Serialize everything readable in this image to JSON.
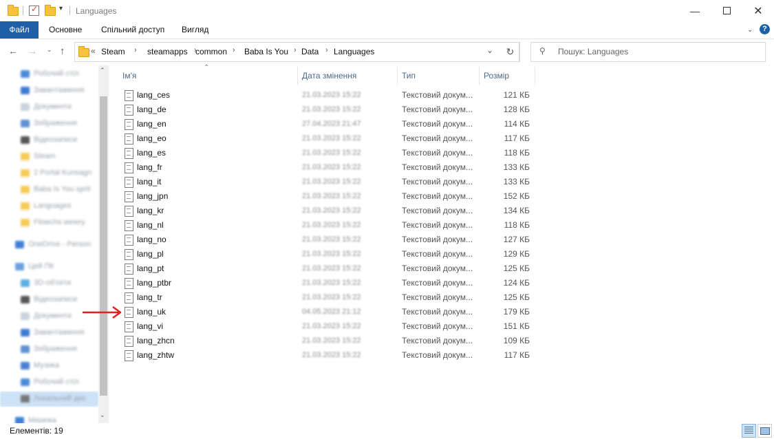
{
  "window": {
    "title": "Languages"
  },
  "ribbon": {
    "tabs": [
      "Файл",
      "Основне",
      "Спільний доступ",
      "Вигляд"
    ]
  },
  "address": {
    "overflow": "«",
    "crumbs": [
      "Steam",
      "steamapps",
      "common",
      "Baba Is You",
      "Data",
      "Languages"
    ]
  },
  "search": {
    "placeholder": "Пошук: Languages"
  },
  "columns": {
    "name": "Ім'я",
    "date": "Дата змінення",
    "type": "Тип",
    "size": "Розмір"
  },
  "files": [
    {
      "name": "lang_ces",
      "date": "21.03.2023 15:22",
      "type": "Текстовий докум...",
      "size": "121 КБ"
    },
    {
      "name": "lang_de",
      "date": "21.03.2023 15:22",
      "type": "Текстовий докум...",
      "size": "128 КБ"
    },
    {
      "name": "lang_en",
      "date": "27.04.2023 21:47",
      "type": "Текстовий докум...",
      "size": "114 КБ"
    },
    {
      "name": "lang_eo",
      "date": "21.03.2023 15:22",
      "type": "Текстовий докум...",
      "size": "117 КБ"
    },
    {
      "name": "lang_es",
      "date": "21.03.2023 15:22",
      "type": "Текстовий докум...",
      "size": "118 КБ"
    },
    {
      "name": "lang_fr",
      "date": "21.03.2023 15:22",
      "type": "Текстовий докум...",
      "size": "133 КБ"
    },
    {
      "name": "lang_it",
      "date": "21.03.2023 15:22",
      "type": "Текстовий докум...",
      "size": "133 КБ"
    },
    {
      "name": "lang_jpn",
      "date": "21.03.2023 15:22",
      "type": "Текстовий докум...",
      "size": "152 КБ"
    },
    {
      "name": "lang_kr",
      "date": "21.03.2023 15:22",
      "type": "Текстовий докум...",
      "size": "134 КБ"
    },
    {
      "name": "lang_nl",
      "date": "21.03.2023 15:22",
      "type": "Текстовий докум...",
      "size": "118 КБ"
    },
    {
      "name": "lang_no",
      "date": "21.03.2023 15:22",
      "type": "Текстовий докум...",
      "size": "127 КБ"
    },
    {
      "name": "lang_pl",
      "date": "21.03.2023 15:22",
      "type": "Текстовий докум...",
      "size": "129 КБ"
    },
    {
      "name": "lang_pt",
      "date": "21.03.2023 15:22",
      "type": "Текстовий докум...",
      "size": "125 КБ"
    },
    {
      "name": "lang_ptbr",
      "date": "21.03.2023 15:22",
      "type": "Текстовий докум...",
      "size": "124 КБ"
    },
    {
      "name": "lang_tr",
      "date": "21.03.2023 15:22",
      "type": "Текстовий докум...",
      "size": "125 КБ"
    },
    {
      "name": "lang_uk",
      "date": "04.05.2023 21:12",
      "type": "Текстовий докум...",
      "size": "179 КБ"
    },
    {
      "name": "lang_vi",
      "date": "21.03.2023 15:22",
      "type": "Текстовий докум...",
      "size": "151 КБ"
    },
    {
      "name": "lang_zhcn",
      "date": "21.03.2023 15:22",
      "type": "Текстовий докум...",
      "size": "109 КБ"
    },
    {
      "name": "lang_zhtw",
      "date": "21.03.2023 15:22",
      "type": "Текстовий докум...",
      "size": "117 КБ"
    }
  ],
  "nav": {
    "items": [
      {
        "label": "Робочий стіл",
        "icon": "desktop-icon"
      },
      {
        "label": "Завантаження",
        "icon": "download-icon"
      },
      {
        "label": "Документи",
        "icon": "documents-icon"
      },
      {
        "label": "Зображення",
        "icon": "pictures-icon"
      },
      {
        "label": "Відеозаписи",
        "icon": "video-icon"
      },
      {
        "label": "Steam",
        "icon": "folder-icon"
      },
      {
        "label": "2 Portal Kunsagn",
        "icon": "folder-icon"
      },
      {
        "label": "Baba Is You sprit",
        "icon": "folder-icon"
      },
      {
        "label": "Languages",
        "icon": "folder-icon"
      },
      {
        "label": "Flowchs wewry",
        "icon": "folder-icon"
      },
      {
        "label": "OneDrive - Person",
        "icon": "onedrive-icon"
      },
      {
        "label": "Цей ПК",
        "icon": "pc-icon"
      },
      {
        "label": "3D-об'єкти",
        "icon": "3d-objects-icon"
      },
      {
        "label": "Відеозаписи",
        "icon": "video-icon"
      },
      {
        "label": "Документи",
        "icon": "documents-icon"
      },
      {
        "label": "Завантаження",
        "icon": "download-icon"
      },
      {
        "label": "Зображення",
        "icon": "pictures-icon"
      },
      {
        "label": "Музика",
        "icon": "music-icon"
      },
      {
        "label": "Робочий стіл",
        "icon": "desktop-icon"
      },
      {
        "label": "Локальний дис",
        "icon": "drive-icon"
      },
      {
        "label": "Мережа",
        "icon": "network-icon"
      }
    ]
  },
  "status": {
    "items_count": "Елементів: 19"
  },
  "colors": {
    "accent": "#1f5fa8",
    "arrow": "#e02020",
    "folder": "#f8c33a"
  }
}
